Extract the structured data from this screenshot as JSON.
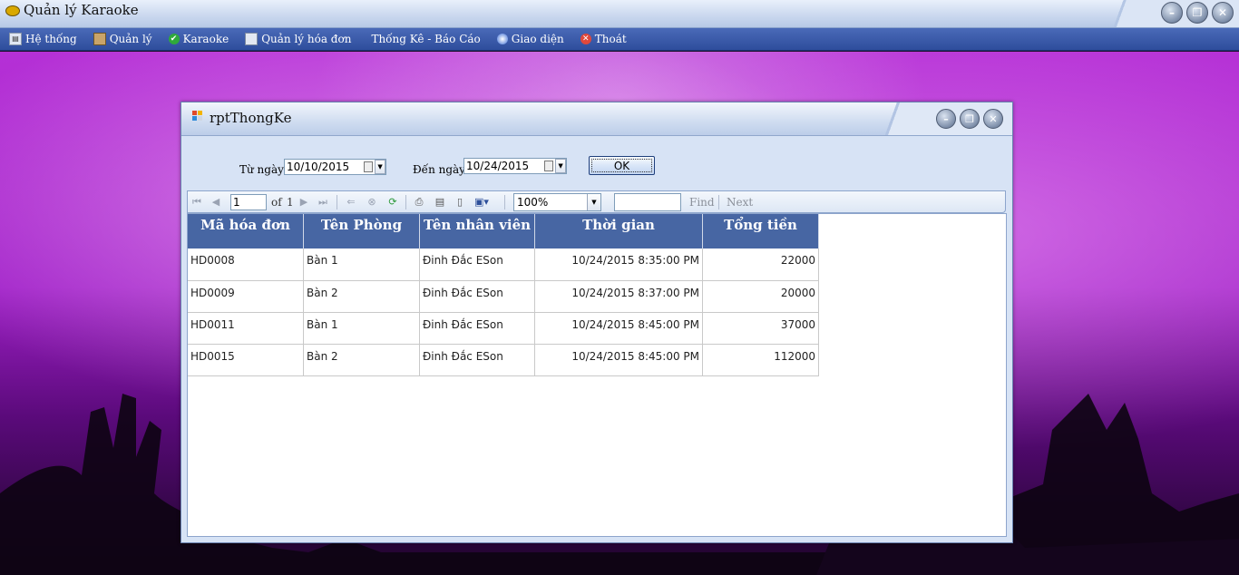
{
  "app": {
    "title": "Quản lý Karaoke"
  },
  "window_buttons": {
    "minimize": "–",
    "restore": "❐",
    "close": "✕"
  },
  "menu": [
    {
      "label": "Hệ thống",
      "icon": "system-icon"
    },
    {
      "label": "Quản lý",
      "icon": "book-icon"
    },
    {
      "label": "Karaoke",
      "icon": "check-icon"
    },
    {
      "label": "Quản lý hóa đơn",
      "icon": "invoice-icon"
    },
    {
      "label": "Thống Kê - Báo Cáo",
      "icon": ""
    },
    {
      "label": "Giao diện",
      "icon": "theme-icon"
    },
    {
      "label": "Thoát",
      "icon": "exit-icon"
    }
  ],
  "report_window": {
    "title": "rptThongKe",
    "from_label": "Từ ngày",
    "from_value": "10/10/2015",
    "to_label": "Đến ngày",
    "to_value": "10/24/2015",
    "ok_label": "OK"
  },
  "toolbar": {
    "page_value": "1",
    "of_label": "of",
    "total_pages": "1",
    "zoom_value": "100%",
    "find_label": "Find",
    "next_label": "Next"
  },
  "table": {
    "headers": [
      "Mã hóa đơn",
      "Tên Phòng",
      "Tên nhân viên",
      "Thời gian",
      "Tổng tiền"
    ],
    "rows": [
      [
        "HD0008",
        "Bàn 1",
        "Đinh Đắc ESon",
        "10/24/2015 8:35:00 PM",
        "22000"
      ],
      [
        "HD0009",
        "Bàn 2",
        "Đinh Đắc ESon",
        "10/24/2015 8:37:00 PM",
        "20000"
      ],
      [
        "HD0011",
        "Bàn 1",
        "Đinh Đắc ESon",
        "10/24/2015 8:45:00 PM",
        "37000"
      ],
      [
        "HD0015",
        "Bàn 2",
        "Đinh Đắc ESon",
        "10/24/2015 8:45:00 PM",
        "112000"
      ]
    ]
  }
}
